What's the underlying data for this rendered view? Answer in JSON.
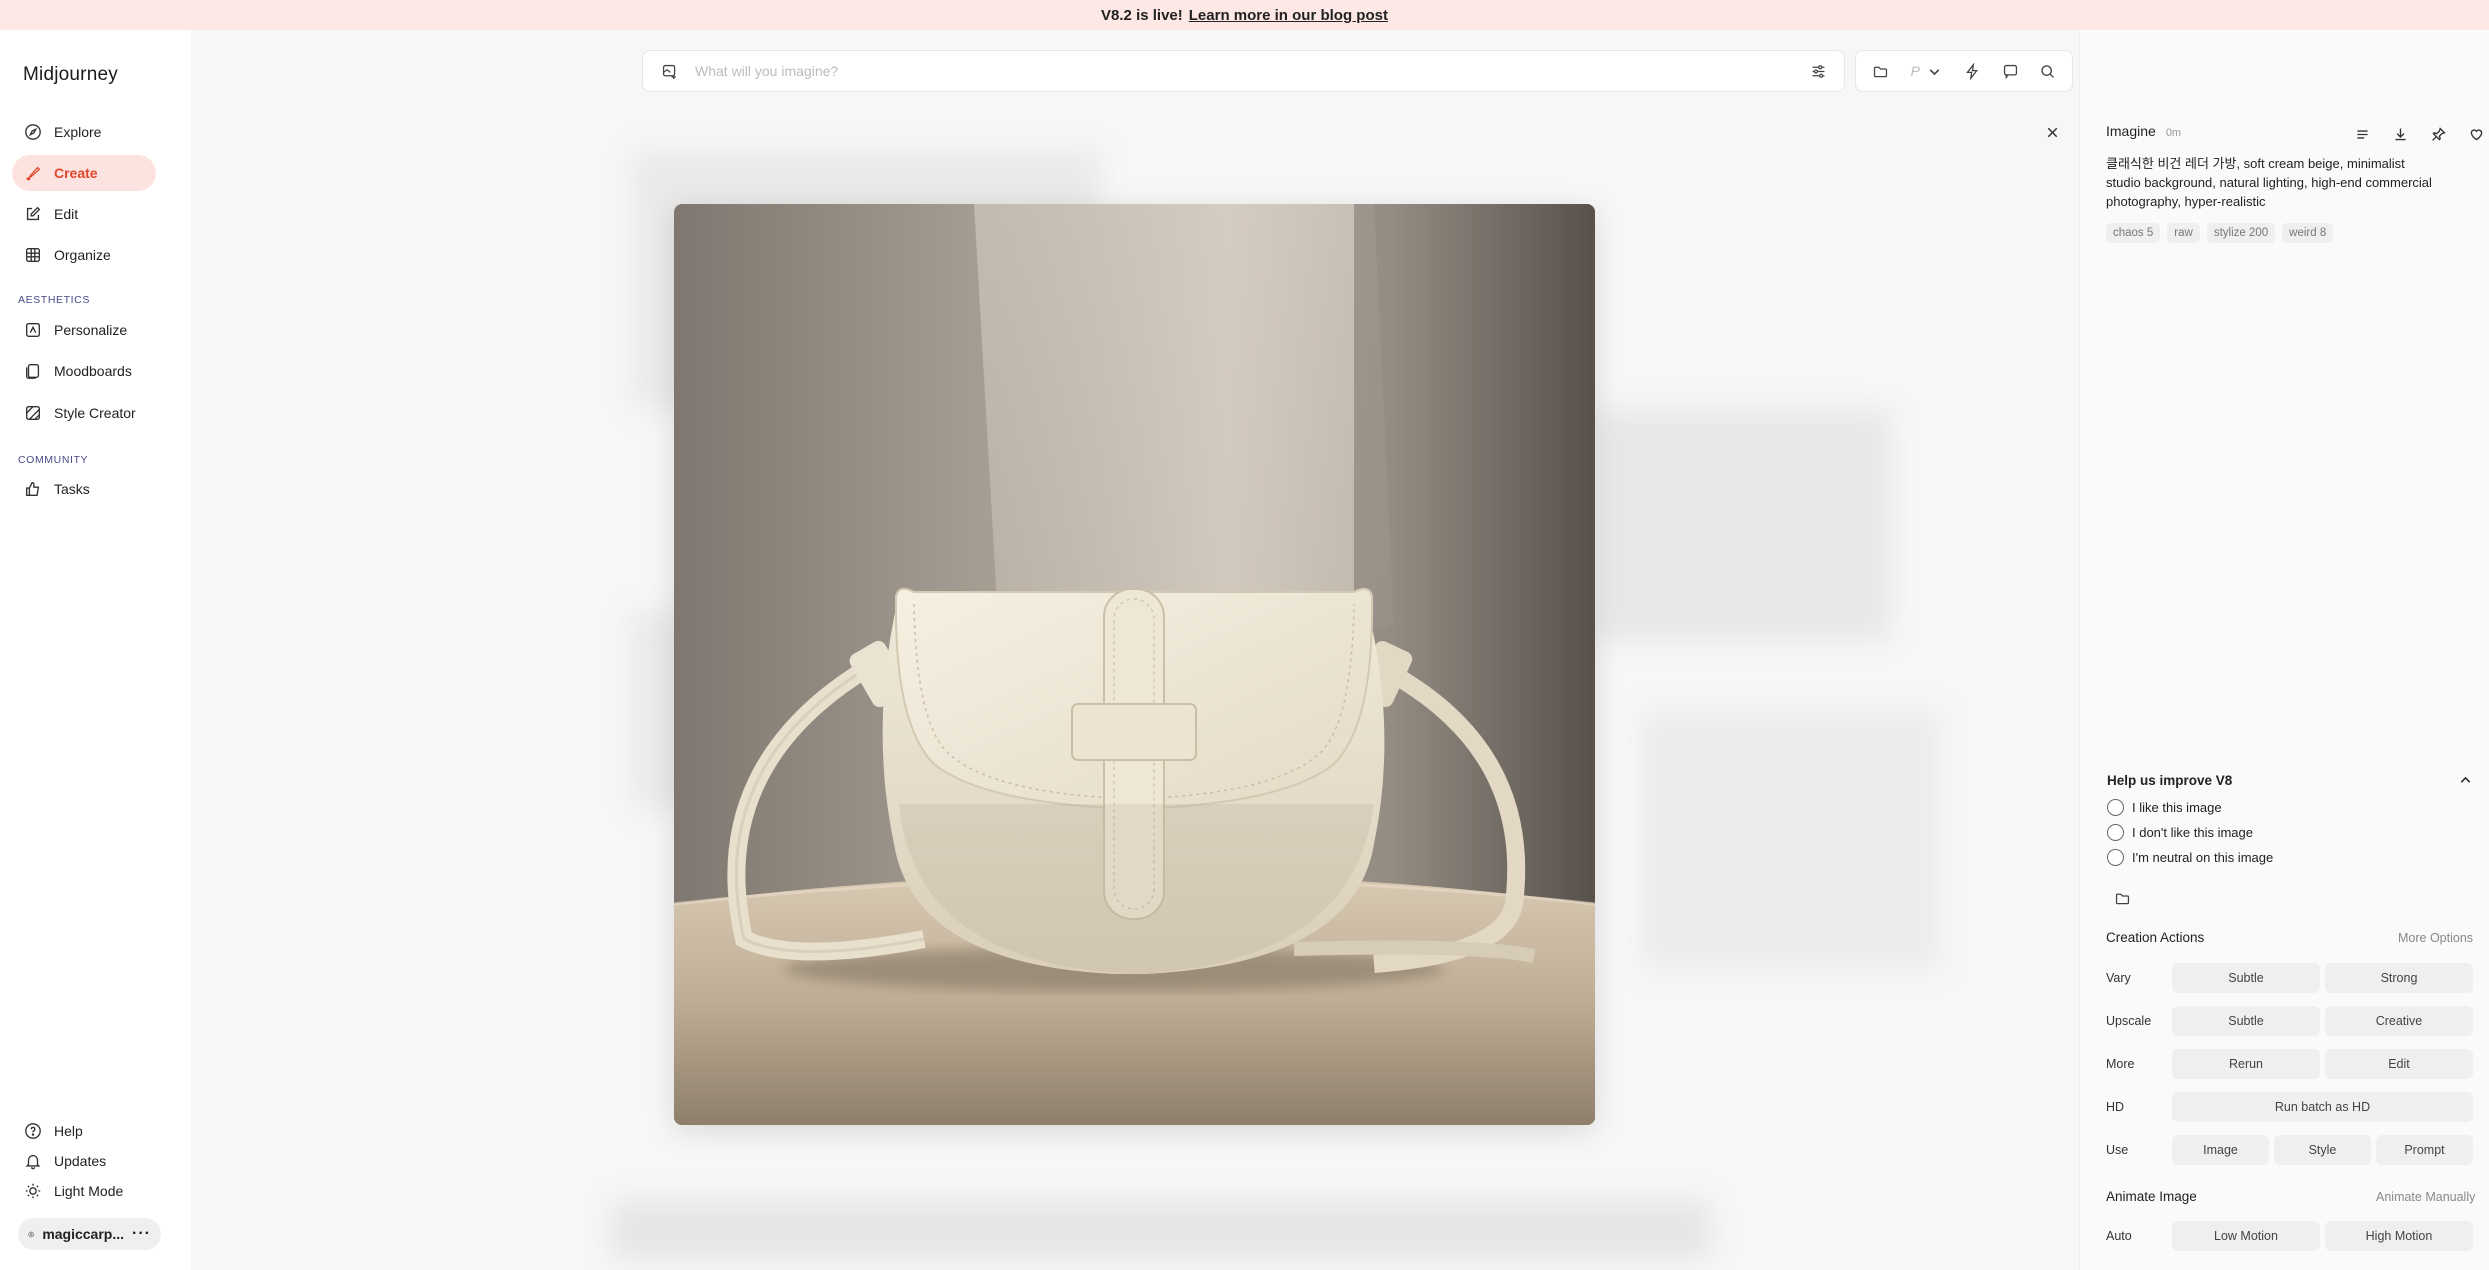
{
  "banner": {
    "text": "V8.2 is live!",
    "link": "Learn more in our blog post"
  },
  "sidebar": {
    "logo": "Midjourney",
    "items": [
      {
        "label": "Explore",
        "icon": "compass-icon"
      },
      {
        "label": "Create",
        "icon": "brush-icon",
        "active": true
      },
      {
        "label": "Edit",
        "icon": "edit-icon"
      },
      {
        "label": "Organize",
        "icon": "grid-icon"
      }
    ],
    "aesthetics_label": "AESTHETICS",
    "aesthetics_items": [
      {
        "label": "Personalize",
        "icon": "personalize-icon"
      },
      {
        "label": "Moodboards",
        "icon": "moodboard-icon"
      },
      {
        "label": "Style Creator",
        "icon": "style-creator-icon"
      }
    ],
    "community_label": "COMMUNITY",
    "community_items": [
      {
        "label": "Tasks",
        "icon": "thumbs-up-icon"
      }
    ],
    "footer_items": [
      {
        "label": "Help",
        "icon": "help-icon"
      },
      {
        "label": "Updates",
        "icon": "bell-icon"
      },
      {
        "label": "Light Mode",
        "icon": "sun-icon"
      }
    ],
    "user": "magiccarp..."
  },
  "search": {
    "placeholder": "What will you imagine?"
  },
  "panel": {
    "job_type": "Imagine",
    "time": "0m",
    "prompt": "클래식한 비건 레더 가방, soft cream beige, minimalist studio background, natural lighting, high-end commercial photography, hyper-realistic",
    "tags": [
      "chaos 5",
      "raw",
      "stylize 200",
      "weird 8"
    ],
    "feedback": {
      "title": "Help us improve V8",
      "options": [
        "I like this image",
        "I don't like this image",
        "I'm neutral on this image"
      ]
    },
    "creation_actions": {
      "title": "Creation Actions",
      "more": "More Options",
      "rows": [
        {
          "label": "Vary",
          "buttons": [
            "Subtle",
            "Strong"
          ]
        },
        {
          "label": "Upscale",
          "buttons": [
            "Subtle",
            "Creative"
          ]
        },
        {
          "label": "More",
          "buttons": [
            "Rerun",
            "Edit"
          ]
        },
        {
          "label": "HD",
          "buttons": [
            "Run batch as HD"
          ]
        },
        {
          "label": "Use",
          "buttons": [
            "Image",
            "Style",
            "Prompt"
          ]
        }
      ]
    },
    "animate": {
      "title": "Animate Image",
      "manual": "Animate Manually",
      "auto_label": "Auto",
      "buttons": [
        "Low Motion",
        "High Motion"
      ]
    }
  },
  "colors": {
    "accent": "#e0472e",
    "active_bg": "#fde3df",
    "banner_bg": "#fde8e6"
  }
}
